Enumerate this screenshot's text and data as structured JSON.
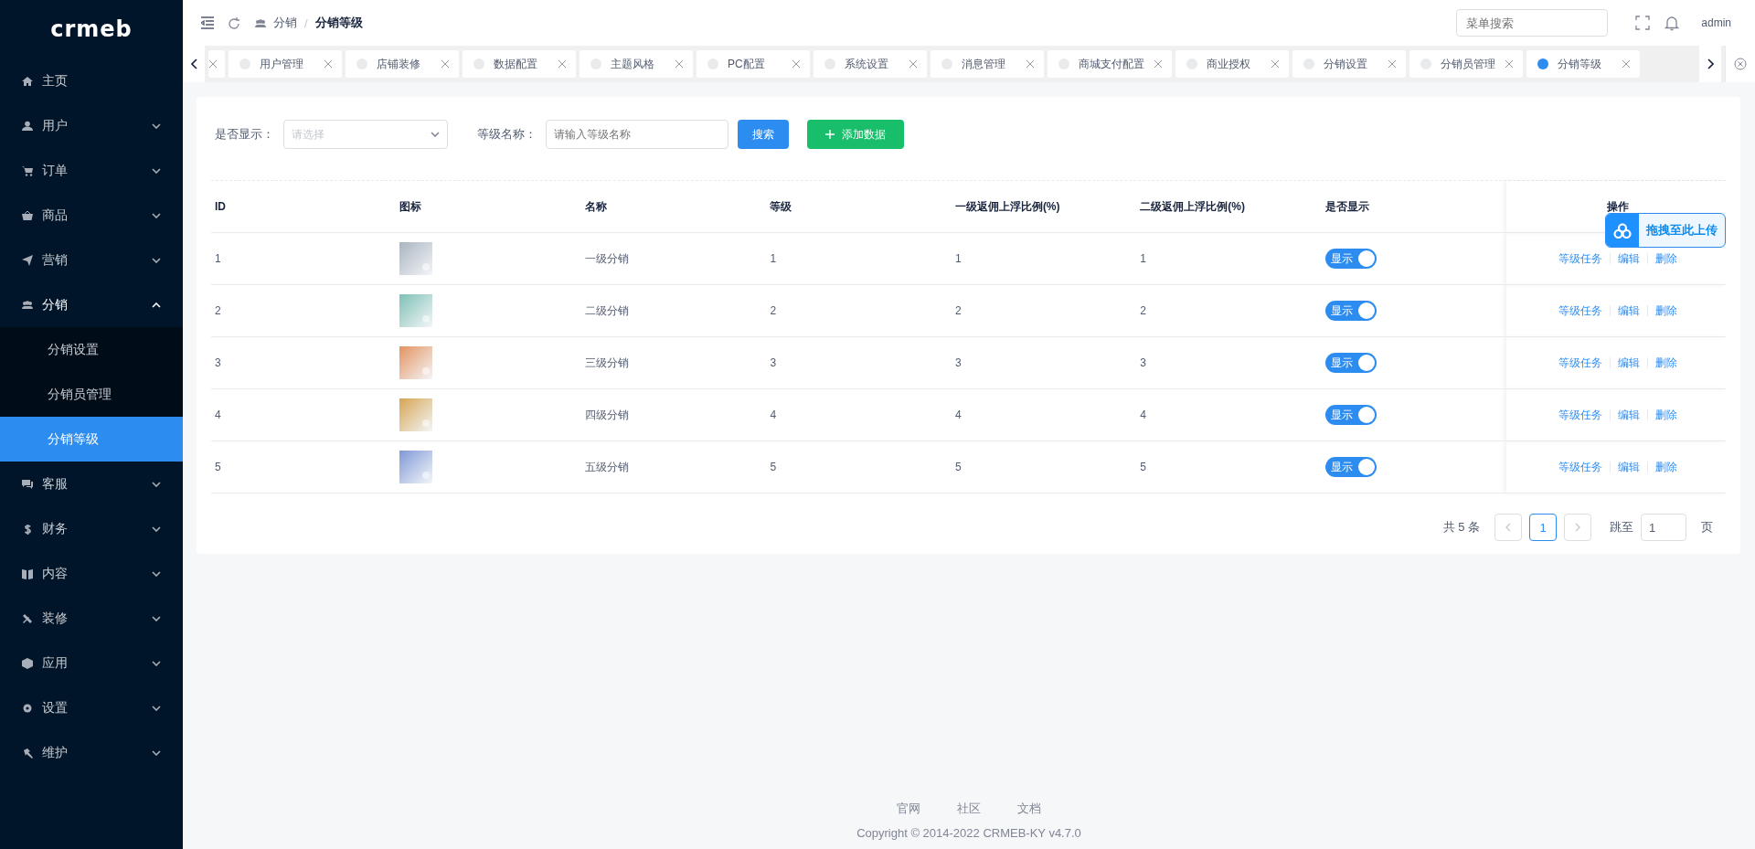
{
  "sidebar": {
    "logo": "crmeb",
    "items": [
      {
        "label": "主页",
        "kind": "link"
      },
      {
        "label": "用户",
        "kind": "group",
        "expanded": false
      },
      {
        "label": "订单",
        "kind": "group",
        "expanded": false
      },
      {
        "label": "商品",
        "kind": "group",
        "expanded": false
      },
      {
        "label": "营销",
        "kind": "group",
        "expanded": false
      },
      {
        "label": "分销",
        "kind": "group",
        "expanded": true,
        "children": [
          {
            "label": "分销设置",
            "selected": false
          },
          {
            "label": "分销员管理",
            "selected": false
          },
          {
            "label": "分销等级",
            "selected": true
          }
        ]
      },
      {
        "label": "客服",
        "kind": "group",
        "expanded": false
      },
      {
        "label": "财务",
        "kind": "group",
        "expanded": false
      },
      {
        "label": "内容",
        "kind": "group",
        "expanded": false
      },
      {
        "label": "装修",
        "kind": "group",
        "expanded": false
      },
      {
        "label": "应用",
        "kind": "group",
        "expanded": false
      },
      {
        "label": "设置",
        "kind": "group",
        "expanded": false
      },
      {
        "label": "维护",
        "kind": "group",
        "expanded": false
      }
    ]
  },
  "header": {
    "breadcrumb": [
      "分销",
      "分销等级"
    ],
    "breadcrumb_separator": "/",
    "search": {
      "placeholder": "菜单搜索"
    },
    "user": "admin"
  },
  "tabs": [
    {
      "label": "用户管理",
      "selected": false
    },
    {
      "label": "店铺装修",
      "selected": false
    },
    {
      "label": "数据配置",
      "selected": false
    },
    {
      "label": "主题风格",
      "selected": false
    },
    {
      "label": "PC配置",
      "selected": false
    },
    {
      "label": "系统设置",
      "selected": false
    },
    {
      "label": "消息管理",
      "selected": false
    },
    {
      "label": "商城支付配置",
      "selected": false
    },
    {
      "label": "商业授权",
      "selected": false
    },
    {
      "label": "分销设置",
      "selected": false
    },
    {
      "label": "分销员管理",
      "selected": false
    },
    {
      "label": "分销等级",
      "selected": true
    }
  ],
  "filters": [
    {
      "kind": "select",
      "label": "是否显示：",
      "placeholder": "请选择"
    },
    {
      "kind": "input",
      "label": "等级名称：",
      "placeholder": "请输入等级名称"
    }
  ],
  "buttons": [
    {
      "kind": "primary",
      "label": "搜索"
    },
    {
      "kind": "success",
      "label": "添加数据"
    }
  ],
  "table": {
    "columns": [
      "ID",
      "图标",
      "名称",
      "等级",
      "一级返佣上浮比例(%)",
      "二级返佣上浮比例(%)",
      "是否显示",
      "操作"
    ],
    "rows": [
      {
        "id": "1",
        "name": "一级分销",
        "grade": "1",
        "ratio_1": "1",
        "ratio_2": "1",
        "show": {
          "on": true,
          "label": "显示"
        },
        "actions": [
          "等级任务",
          "编辑",
          "删除"
        ]
      },
      {
        "id": "2",
        "name": "二级分销",
        "grade": "2",
        "ratio_1": "2",
        "ratio_2": "2",
        "show": {
          "on": true,
          "label": "显示"
        },
        "actions": [
          "等级任务",
          "编辑",
          "删除"
        ]
      },
      {
        "id": "3",
        "name": "三级分销",
        "grade": "3",
        "ratio_1": "3",
        "ratio_2": "3",
        "show": {
          "on": true,
          "label": "显示"
        },
        "actions": [
          "等级任务",
          "编辑",
          "删除"
        ]
      },
      {
        "id": "4",
        "name": "四级分销",
        "grade": "4",
        "ratio_1": "4",
        "ratio_2": "4",
        "show": {
          "on": true,
          "label": "显示"
        },
        "actions": [
          "等级任务",
          "编辑",
          "删除"
        ]
      },
      {
        "id": "5",
        "name": "五级分销",
        "grade": "5",
        "ratio_1": "5",
        "ratio_2": "5",
        "show": {
          "on": true,
          "label": "显示"
        },
        "actions": [
          "等级任务",
          "编辑",
          "删除"
        ]
      }
    ]
  },
  "pagination": {
    "total": "共 5 条",
    "pages": [
      {
        "label": "1",
        "selected": true
      }
    ],
    "jump_label": "跳至",
    "jump_value": "1",
    "page_unit": "页"
  },
  "footer": {
    "links": [
      "官网",
      "社区",
      "文档"
    ],
    "copyright": "Copyright © 2014-2022 CRMEB-KY v4.7.0"
  },
  "upload_widget": {
    "label": "拖拽至此上传"
  }
}
